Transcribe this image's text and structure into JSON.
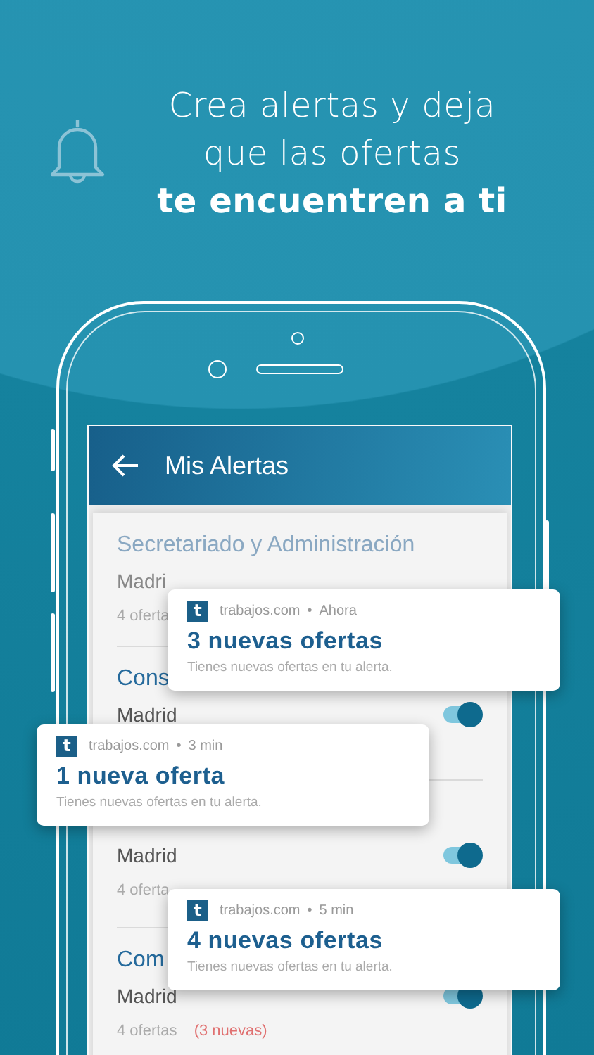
{
  "headline": {
    "lines": [
      {
        "text": "Crea alertas y deja",
        "bold": false
      },
      {
        "text": "que las ofertas",
        "bold": false
      },
      {
        "text": "te encuentren a ti",
        "bold": true
      }
    ]
  },
  "app": {
    "title": "Mis Alertas",
    "alerts": [
      {
        "title": "Secretariado y Administración",
        "city": "Madri",
        "count": "4 oferta",
        "faded": true
      },
      {
        "title": "Cons",
        "city": "Madrid",
        "on": true,
        "faded": false
      },
      {
        "city": "Madrid",
        "count": "4 oferta",
        "on": true,
        "faded": false
      },
      {
        "title": "Com",
        "city": "Madrid",
        "count": "4 ofertas",
        "new": "(3 nuevas)",
        "on": true,
        "faded": false
      }
    ]
  },
  "notifications": [
    {
      "logo_letter": "t",
      "source": "trabajos.com",
      "separator": "•",
      "time": "Ahora",
      "title": "3 nuevas ofertas",
      "body": "Tienes nuevas ofertas en tu alerta."
    },
    {
      "logo_letter": "t",
      "source": "trabajos.com",
      "separator": "•",
      "time": "3 min",
      "title": "1 nueva oferta",
      "body": "Tienes nuevas ofertas en tu alerta."
    },
    {
      "logo_letter": "t",
      "source": "trabajos.com",
      "separator": "•",
      "time": "5 min",
      "title": "4 nuevas ofertas",
      "body": "Tienes nuevas ofertas en tu alerta."
    }
  ]
}
